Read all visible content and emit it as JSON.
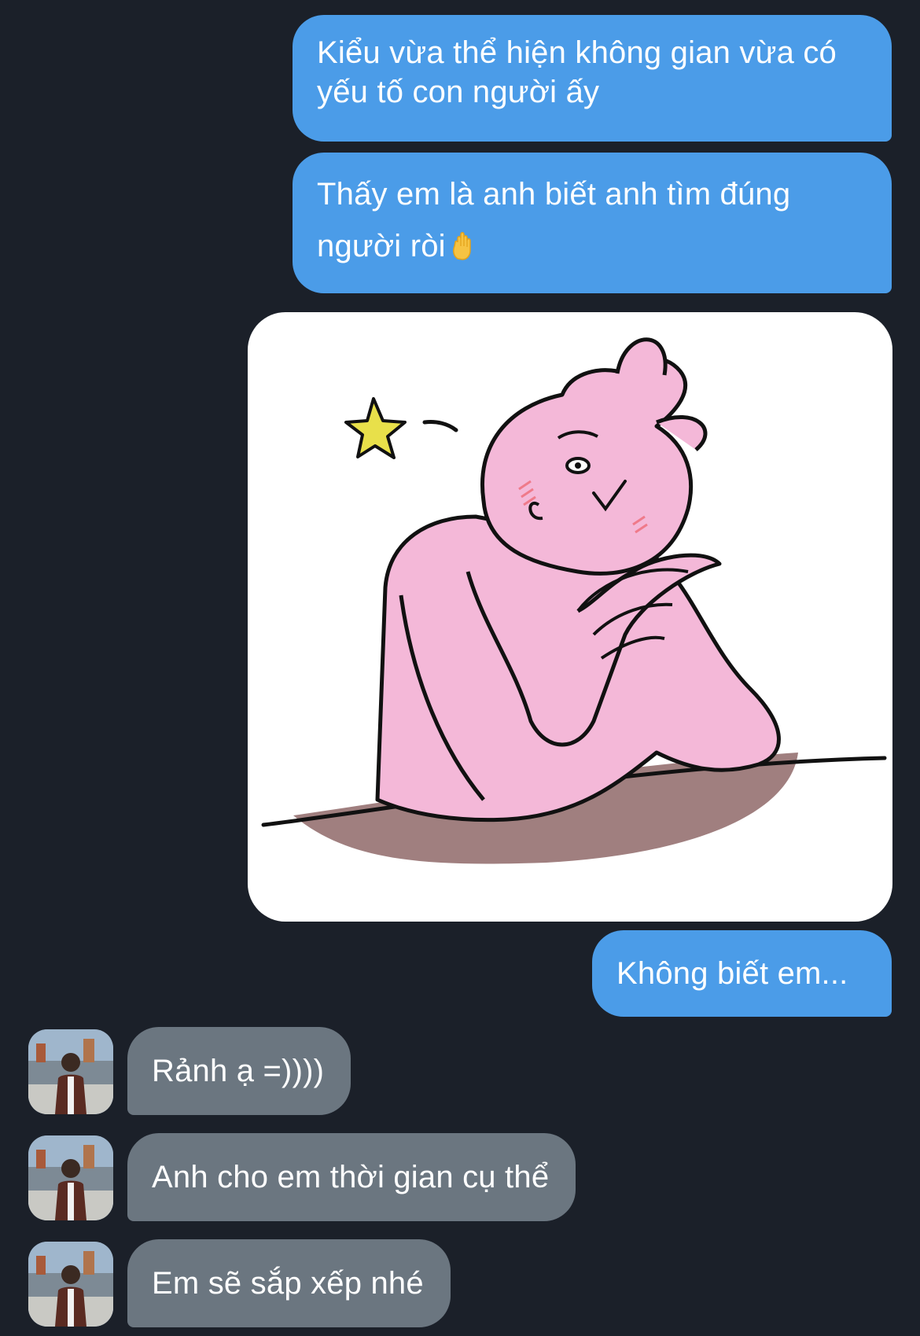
{
  "messages": [
    {
      "id": "m1",
      "direction": "outgoing",
      "type": "text",
      "text": "Kiểu vừa thể hiện không gian vừa có yếu tố con người ấy"
    },
    {
      "id": "m2",
      "direction": "outgoing",
      "type": "text",
      "text": "Thấy em là anh biết anh tìm đúng người ròi",
      "emoji": "hand-icon"
    },
    {
      "id": "m3",
      "direction": "outgoing",
      "type": "sticker",
      "sticker": "pink-bunny-thinking-sticker"
    },
    {
      "id": "m4",
      "direction": "outgoing",
      "type": "text",
      "text": "Không biết em..."
    },
    {
      "id": "m5",
      "direction": "incoming",
      "type": "text",
      "text": "Rảnh ạ =))))"
    },
    {
      "id": "m6",
      "direction": "incoming",
      "type": "text",
      "text": "Anh cho em thời gian cụ thể"
    },
    {
      "id": "m7",
      "direction": "incoming",
      "type": "text",
      "text": "Em sẽ sắp xếp nhé"
    }
  ],
  "colors": {
    "background": "#1b2029",
    "outgoing_bubble": "#4b9ce8",
    "incoming_bubble": "#6b7680",
    "text": "#ffffff",
    "sticker_pink": "#f4b8d8",
    "sticker_table": "#a07f7f",
    "sticker_star": "#e8e04a"
  }
}
